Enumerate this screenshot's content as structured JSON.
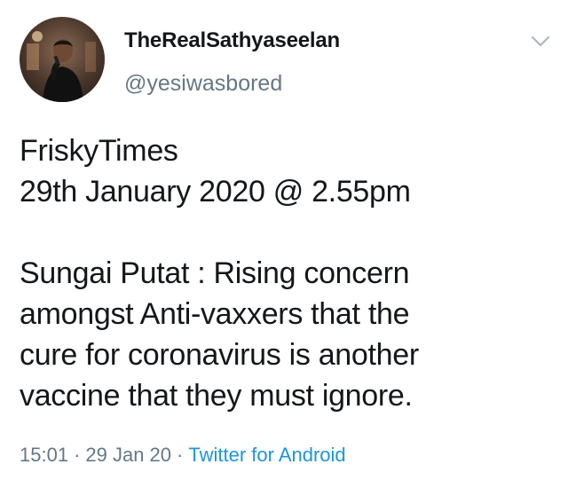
{
  "user": {
    "display_name": "TheRealSathyaseelan",
    "handle": "@yesiwasbored",
    "avatar_icon": "user-avatar-photo"
  },
  "menu": {
    "icon": "chevron-down-icon",
    "color": "#aab8c2"
  },
  "tweet": {
    "text": "FriskyTimes\n29th January 2020 @ 2.55pm\n\nSungai Putat : Rising concern\namongst Anti-vaxxers that the\ncure for coronavirus is another\nvaccine that they must ignore."
  },
  "meta": {
    "time": "15:01",
    "separator": "·",
    "date": "29 Jan 20",
    "source": "Twitter for Android"
  },
  "colors": {
    "text": "#14171a",
    "secondary": "#657786",
    "link": "#1b95e0"
  }
}
